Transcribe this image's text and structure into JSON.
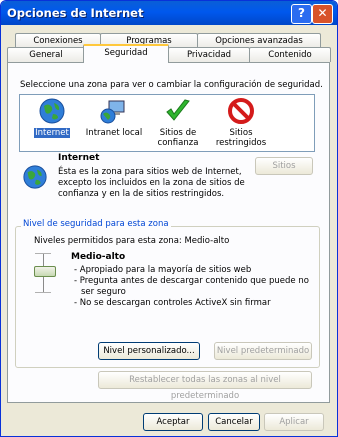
{
  "window": {
    "title": "Opciones de Internet",
    "help": "?",
    "close": "✕"
  },
  "tabs": {
    "row1": [
      "Conexiones",
      "Programas",
      "Opciones avanzadas"
    ],
    "row2": [
      "General",
      "Seguridad",
      "Privacidad",
      "Contenido"
    ],
    "active": "Seguridad"
  },
  "security": {
    "instruction": "Seleccione una zona para ver o cambiar la configuración de seguridad.",
    "zones": [
      {
        "name": "Internet",
        "icon": "globe-icon"
      },
      {
        "name": "Intranet local",
        "icon": "computer-network-icon"
      },
      {
        "name": "Sitios de confianza",
        "line1": "Sitios de",
        "line2": "confianza",
        "icon": "checkmark-icon"
      },
      {
        "name": "Sitios restringidos",
        "line1": "Sitios",
        "line2": "restringidos",
        "icon": "no-entry-icon"
      }
    ],
    "selected_zone": "Internet",
    "zone_title": "Internet",
    "zone_desc": [
      "Ésta es la zona para sitios web de Internet,",
      "excepto los incluidos en la zona de sitios de",
      "confianza y en la de sitios restringidos."
    ],
    "sites_button": "Sitios",
    "level_group_title": "Nivel de seguridad para esta zona",
    "allowed_levels": "Niveles permitidos para esta zona: Medio-alto",
    "level_name": "Medio-alto",
    "level_bullets": [
      "- Apropiado para la mayoría de sitios web",
      "- Pregunta antes de descargar contenido que puede no",
      "ser seguro",
      "- No se descargan controles ActiveX sin firmar"
    ],
    "custom_level_button": "Nivel personalizado...",
    "default_level_button": "Nivel predeterminado",
    "reset_all_button": "Restablecer todas las zonas al nivel predeterminado"
  },
  "footer": {
    "ok": "Aceptar",
    "cancel": "Cancelar",
    "apply": "Aplicar"
  },
  "colors": {
    "titlebar": "#0058ee",
    "face": "#ece9d8",
    "group_title": "#0046d5"
  }
}
